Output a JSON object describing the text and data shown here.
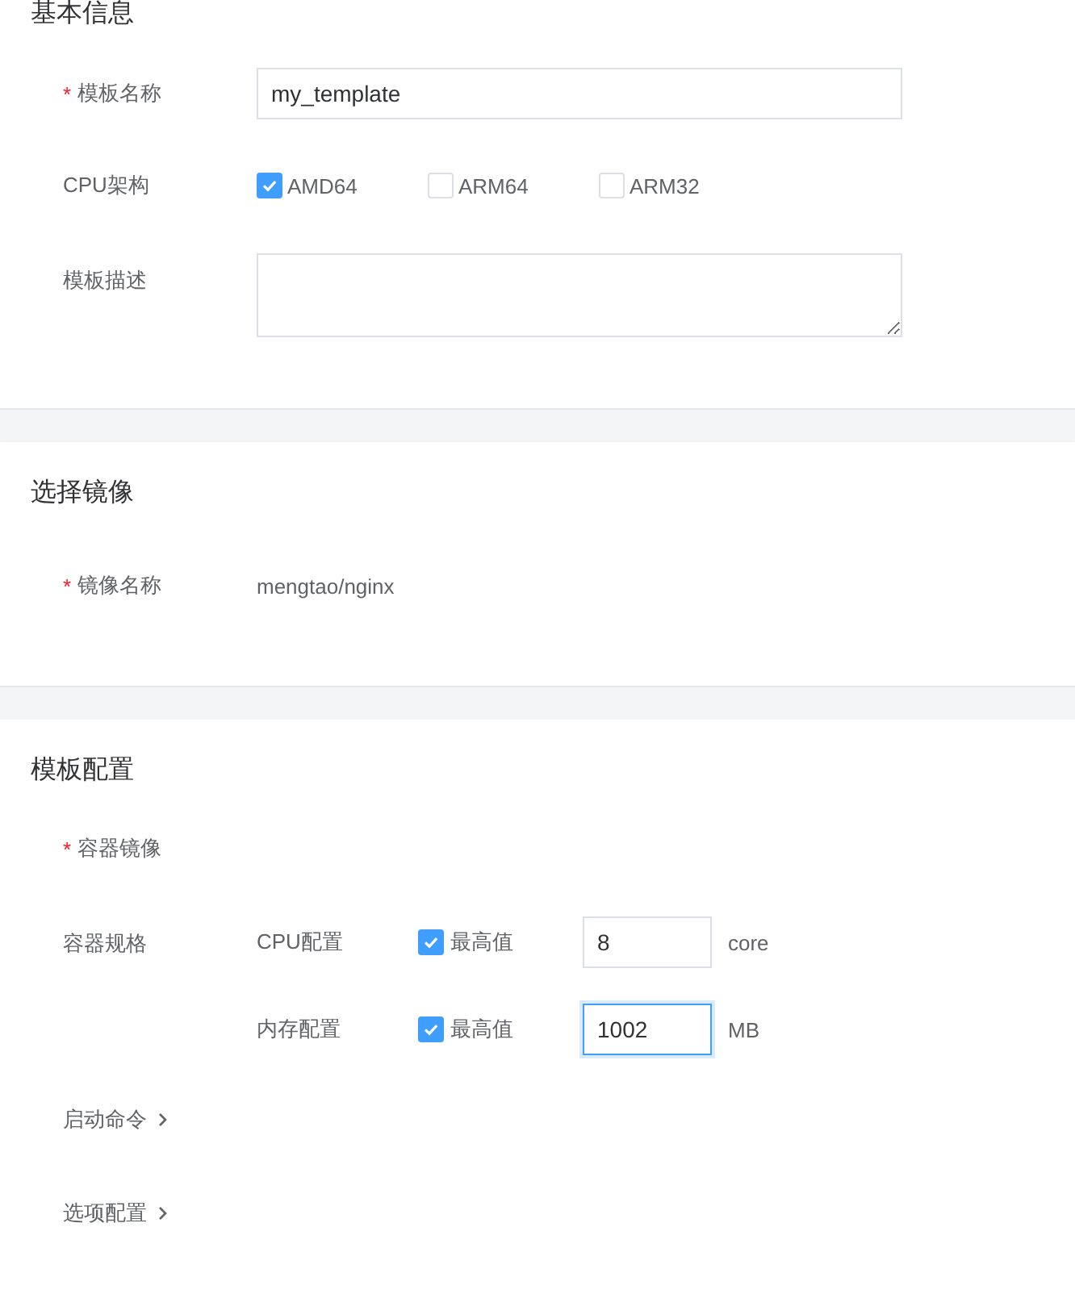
{
  "basic_info": {
    "title": "基本信息",
    "template_name": {
      "mark": "*",
      "label": "模板名称",
      "value": "my_template"
    },
    "cpu_arch": {
      "label": "CPU架构",
      "options": [
        {
          "label": "AMD64",
          "checked": true
        },
        {
          "label": "ARM64",
          "checked": false
        },
        {
          "label": "ARM32",
          "checked": false
        }
      ]
    },
    "description": {
      "label": "模板描述"
    }
  },
  "image_select": {
    "title": "选择镜像",
    "image_name": {
      "mark": "*",
      "label": "镜像名称",
      "value": "mengtao/nginx"
    }
  },
  "template_config": {
    "title": "模板配置",
    "container_image": {
      "mark": "*",
      "label": "容器镜像"
    },
    "container_spec": {
      "label": "容器规格",
      "rows": [
        {
          "label": "CPU配置",
          "max_label": "最高值",
          "checked": true,
          "value": "8",
          "unit": "core",
          "focused": false
        },
        {
          "label": "内存配置",
          "max_label": "最高值",
          "checked": true,
          "value": "1002",
          "unit": "MB",
          "focused": true
        }
      ]
    },
    "collapsibles": [
      {
        "label": "启动命令",
        "expanded": false
      },
      {
        "label": "选项配置",
        "expanded": false
      }
    ]
  }
}
